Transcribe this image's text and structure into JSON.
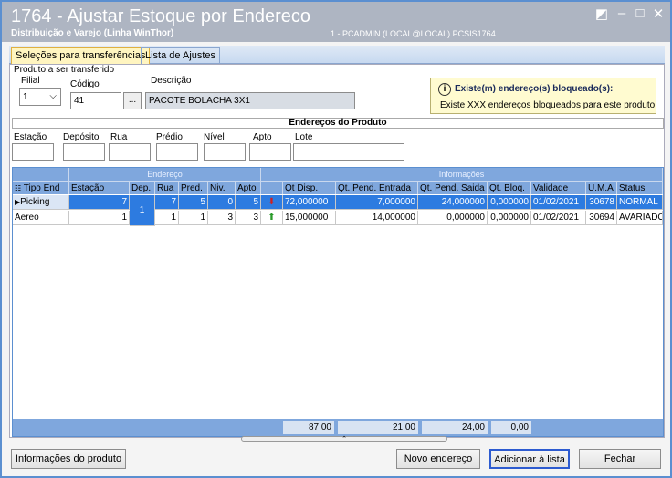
{
  "window": {
    "title": "1764 - Ajustar Estoque por Endereco",
    "subtitle": "Distribuição e Varejo (Linha WinThor)",
    "user_info": "1 - PCADMIN (LOCAL@LOCAL)   PCSIS1764"
  },
  "tabs": [
    "Seleções para transferências",
    "Lista de Ajustes"
  ],
  "produto": {
    "group_label": "Produto a ser transferido",
    "filial_label": "Filial",
    "filial_value": "1",
    "codigo_label": "Código",
    "codigo_value": "41",
    "ellipsis": "...",
    "descricao_label": "Descrição",
    "descricao_value": "PACOTE BOLACHA 3X1"
  },
  "info": {
    "title": "Existe(m) endereço(s) bloqueado(s):",
    "message": "Existe XXX endereços bloqueados para este produto",
    "icon": "info-icon"
  },
  "enderecos": {
    "title": "Endereços do Produto",
    "labels": [
      "Estação",
      "Depósito",
      "Rua",
      "Prédio",
      "Nível",
      "Apto",
      "Lote"
    ]
  },
  "grid": {
    "group_endereco": "Endereço",
    "group_informacoes": "Informações",
    "columns": [
      "Tipo End",
      "Estação",
      "Dep.",
      "Rua",
      "Pred.",
      "Niv.",
      "Apto",
      "",
      "Qt Disp.",
      "Qt. Pend. Entrada",
      "Qt. Pend. Saida",
      "Qt. Bloq.",
      "Validade",
      "U.M.A",
      "Status"
    ],
    "dep_merged": "1",
    "rows": [
      {
        "tipo": "Picking",
        "estacao": "7",
        "rua": "7",
        "pred": "5",
        "niv": "0",
        "apto": "5",
        "arrow": "down",
        "qt_disp": "72,000000",
        "qt_entrada": "7,000000",
        "qt_saida": "24,000000",
        "qt_bloq": "0,000000",
        "validade": "01/02/2021",
        "uma": "30678",
        "status": "NORMAL"
      },
      {
        "tipo": "Aereo",
        "estacao": "1",
        "rua": "1",
        "pred": "1",
        "niv": "3",
        "apto": "3",
        "arrow": "up",
        "qt_disp": "15,000000",
        "qt_entrada": "14,000000",
        "qt_saida": "0,000000",
        "qt_bloq": "0,000000",
        "validade": "01/02/2021",
        "uma": "30694",
        "status": "AVARIADO"
      }
    ],
    "totals": {
      "qt_disp": "87,00",
      "qt_entrada": "21,00",
      "qt_saida": "24,00",
      "qt_bloq": "0,00"
    }
  },
  "buttons": {
    "info_produto": "Informações do produto",
    "novo_endereco": "Novo endereço",
    "adicionar": "Adicionar à lista",
    "fechar": "Fechar"
  },
  "colors": {
    "accent": "#2d7be0",
    "header": "#7fa7dd",
    "up_arrow": "#2a9a2a",
    "down_arrow": "#d02020"
  }
}
